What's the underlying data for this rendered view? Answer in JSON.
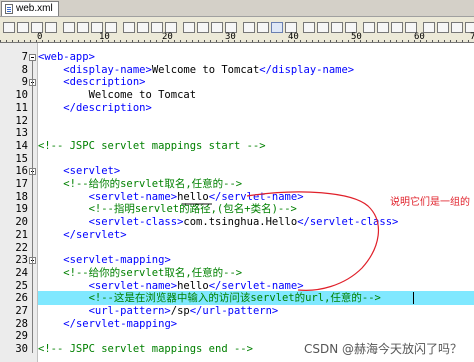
{
  "tab": {
    "label": "web.xml"
  },
  "ruler": {
    "numbers": [
      {
        "label": "0"
      },
      {
        "label": "10"
      },
      {
        "label": "20"
      },
      {
        "label": "30"
      },
      {
        "label": "40"
      },
      {
        "label": "50"
      },
      {
        "label": "60"
      },
      {
        "label": "70"
      }
    ]
  },
  "lines": [
    {
      "num": "7",
      "code": "<web-app>"
    },
    {
      "num": "8",
      "code": "    <display-name>Welcome to Tomcat</display-name>"
    },
    {
      "num": "9",
      "code": "    <description>"
    },
    {
      "num": "10",
      "code": "        Welcome to Tomcat"
    },
    {
      "num": "11",
      "code": "    </description>"
    },
    {
      "num": "12",
      "code": ""
    },
    {
      "num": "13",
      "code": ""
    },
    {
      "num": "14",
      "code": "<!-- JSPC servlet mappings start -->"
    },
    {
      "num": "15",
      "code": ""
    },
    {
      "num": "16",
      "code": "    <servlet>"
    },
    {
      "num": "17",
      "code": "    <!--给你的servlet取名,任意的-->"
    },
    {
      "num": "18",
      "code": "        <servlet-name>hello</servlet-name>"
    },
    {
      "num": "19",
      "code": "        <!--指明servlet的路径,(包名+类名)-->"
    },
    {
      "num": "20",
      "code": "        <servlet-class>com.tsinghua.Hello</servlet-class>"
    },
    {
      "num": "21",
      "code": "    </servlet>"
    },
    {
      "num": "22",
      "code": ""
    },
    {
      "num": "23",
      "code": "    <servlet-mapping>"
    },
    {
      "num": "24",
      "code": "    <!--给你的servlet取名,任意的-->"
    },
    {
      "num": "25",
      "code": "        <servlet-name>hello</servlet-name>"
    },
    {
      "num": "26",
      "code": "        <!--这是在浏览器中输入的访问该servlet的url,任意的-->"
    },
    {
      "num": "27",
      "code": "        <url-pattern>/sp</url-pattern>"
    },
    {
      "num": "28",
      "code": "    </servlet-mapping>"
    },
    {
      "num": "29",
      "code": ""
    },
    {
      "num": "30",
      "code": "<!-- JSPC servlet mappings end -->"
    }
  ],
  "highlighted_line": "26",
  "annotation": "说明它们是一组的",
  "watermark": "CSDN @赫海今天放闪了吗？"
}
